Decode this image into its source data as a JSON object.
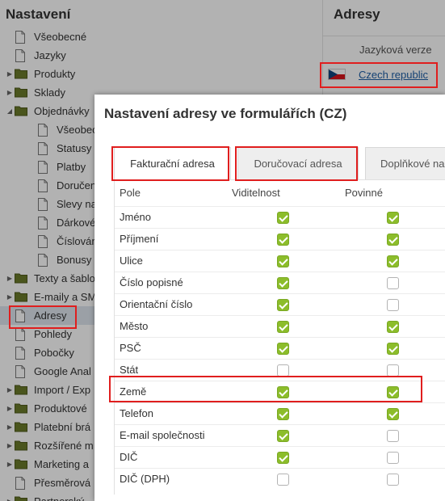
{
  "sidebar": {
    "title": "Nastavení",
    "items": [
      {
        "label": "Všeobecné",
        "depth": 0,
        "icon": "file-icon",
        "toggle": "none"
      },
      {
        "label": "Jazyky",
        "depth": 0,
        "icon": "file-icon",
        "toggle": "none"
      },
      {
        "label": "Produkty",
        "depth": 0,
        "icon": "folder-icon",
        "toggle": "collapsed"
      },
      {
        "label": "Sklady",
        "depth": 0,
        "icon": "folder-icon",
        "toggle": "collapsed"
      },
      {
        "label": "Objednávky",
        "depth": 0,
        "icon": "folder-icon",
        "toggle": "expanded"
      },
      {
        "label": "Všeobecné",
        "depth": 1,
        "icon": "file-icon",
        "toggle": "none"
      },
      {
        "label": "Statusy",
        "depth": 1,
        "icon": "file-icon",
        "toggle": "none"
      },
      {
        "label": "Platby",
        "depth": 1,
        "icon": "file-icon",
        "toggle": "none"
      },
      {
        "label": "Doručení",
        "depth": 1,
        "icon": "file-icon",
        "toggle": "none"
      },
      {
        "label": "Slevy na",
        "depth": 1,
        "icon": "file-icon",
        "toggle": "none"
      },
      {
        "label": "Dárkové",
        "depth": 1,
        "icon": "file-icon",
        "toggle": "none"
      },
      {
        "label": "Číslování",
        "depth": 1,
        "icon": "file-icon",
        "toggle": "none"
      },
      {
        "label": "Bonusy a",
        "depth": 1,
        "icon": "file-icon",
        "toggle": "none"
      },
      {
        "label": "Texty a šablo",
        "depth": 0,
        "icon": "folder-icon",
        "toggle": "collapsed"
      },
      {
        "label": "E-maily a SMS",
        "depth": 0,
        "icon": "folder-icon",
        "toggle": "collapsed"
      },
      {
        "label": "Adresy",
        "depth": 0,
        "icon": "file-icon",
        "toggle": "none",
        "selected": true
      },
      {
        "label": "Pohledy",
        "depth": 0,
        "icon": "file-icon",
        "toggle": "none"
      },
      {
        "label": "Pobočky",
        "depth": 0,
        "icon": "file-icon",
        "toggle": "none"
      },
      {
        "label": "Google Anal",
        "depth": 0,
        "icon": "file-icon",
        "toggle": "none"
      },
      {
        "label": "Import / Exp",
        "depth": 0,
        "icon": "folder-icon",
        "toggle": "collapsed"
      },
      {
        "label": "Produktové",
        "depth": 0,
        "icon": "folder-icon",
        "toggle": "collapsed"
      },
      {
        "label": "Platební brá",
        "depth": 0,
        "icon": "folder-icon",
        "toggle": "collapsed"
      },
      {
        "label": "Rozšířené m",
        "depth": 0,
        "icon": "folder-icon",
        "toggle": "collapsed"
      },
      {
        "label": "Marketing a",
        "depth": 0,
        "icon": "folder-icon",
        "toggle": "collapsed"
      },
      {
        "label": "Přesměrová",
        "depth": 0,
        "icon": "file-icon",
        "toggle": "none"
      },
      {
        "label": "Partnerský",
        "depth": 0,
        "icon": "folder-icon",
        "toggle": "collapsed"
      }
    ]
  },
  "content": {
    "title": "Adresy",
    "language_header": "Jazyková verze",
    "language_link": "Czech republic",
    "flag_icon": "czech-flag-icon"
  },
  "modal": {
    "title": "Nastavení adresy ve formulářích (CZ)",
    "tabs": [
      {
        "label": "Fakturační adresa",
        "active": true
      },
      {
        "label": "Doručovací adresa",
        "active": false
      },
      {
        "label": "Doplňkové na",
        "active": false
      }
    ],
    "table": {
      "headers": [
        "Pole",
        "Viditelnost",
        "Povinné"
      ],
      "rows": [
        {
          "field": "Jméno",
          "visible": true,
          "required": true
        },
        {
          "field": "Příjmení",
          "visible": true,
          "required": true
        },
        {
          "field": "Ulice",
          "visible": true,
          "required": true
        },
        {
          "field": "Číslo popisné",
          "visible": true,
          "required": false
        },
        {
          "field": "Orientační číslo",
          "visible": true,
          "required": false
        },
        {
          "field": "Město",
          "visible": true,
          "required": true
        },
        {
          "field": "PSČ",
          "visible": true,
          "required": true
        },
        {
          "field": "Stát",
          "visible": false,
          "required": false
        },
        {
          "field": "Země",
          "visible": true,
          "required": true
        },
        {
          "field": "Telefon",
          "visible": true,
          "required": true
        },
        {
          "field": "E-mail společnosti",
          "visible": true,
          "required": false
        },
        {
          "field": "DIČ",
          "visible": true,
          "required": false
        },
        {
          "field": "DIČ (DPH)",
          "visible": false,
          "required": false
        }
      ]
    }
  },
  "colors": {
    "checkbox_on": "#8cbd2b",
    "highlight": "#e01e1e",
    "link": "#1f5fa6"
  }
}
